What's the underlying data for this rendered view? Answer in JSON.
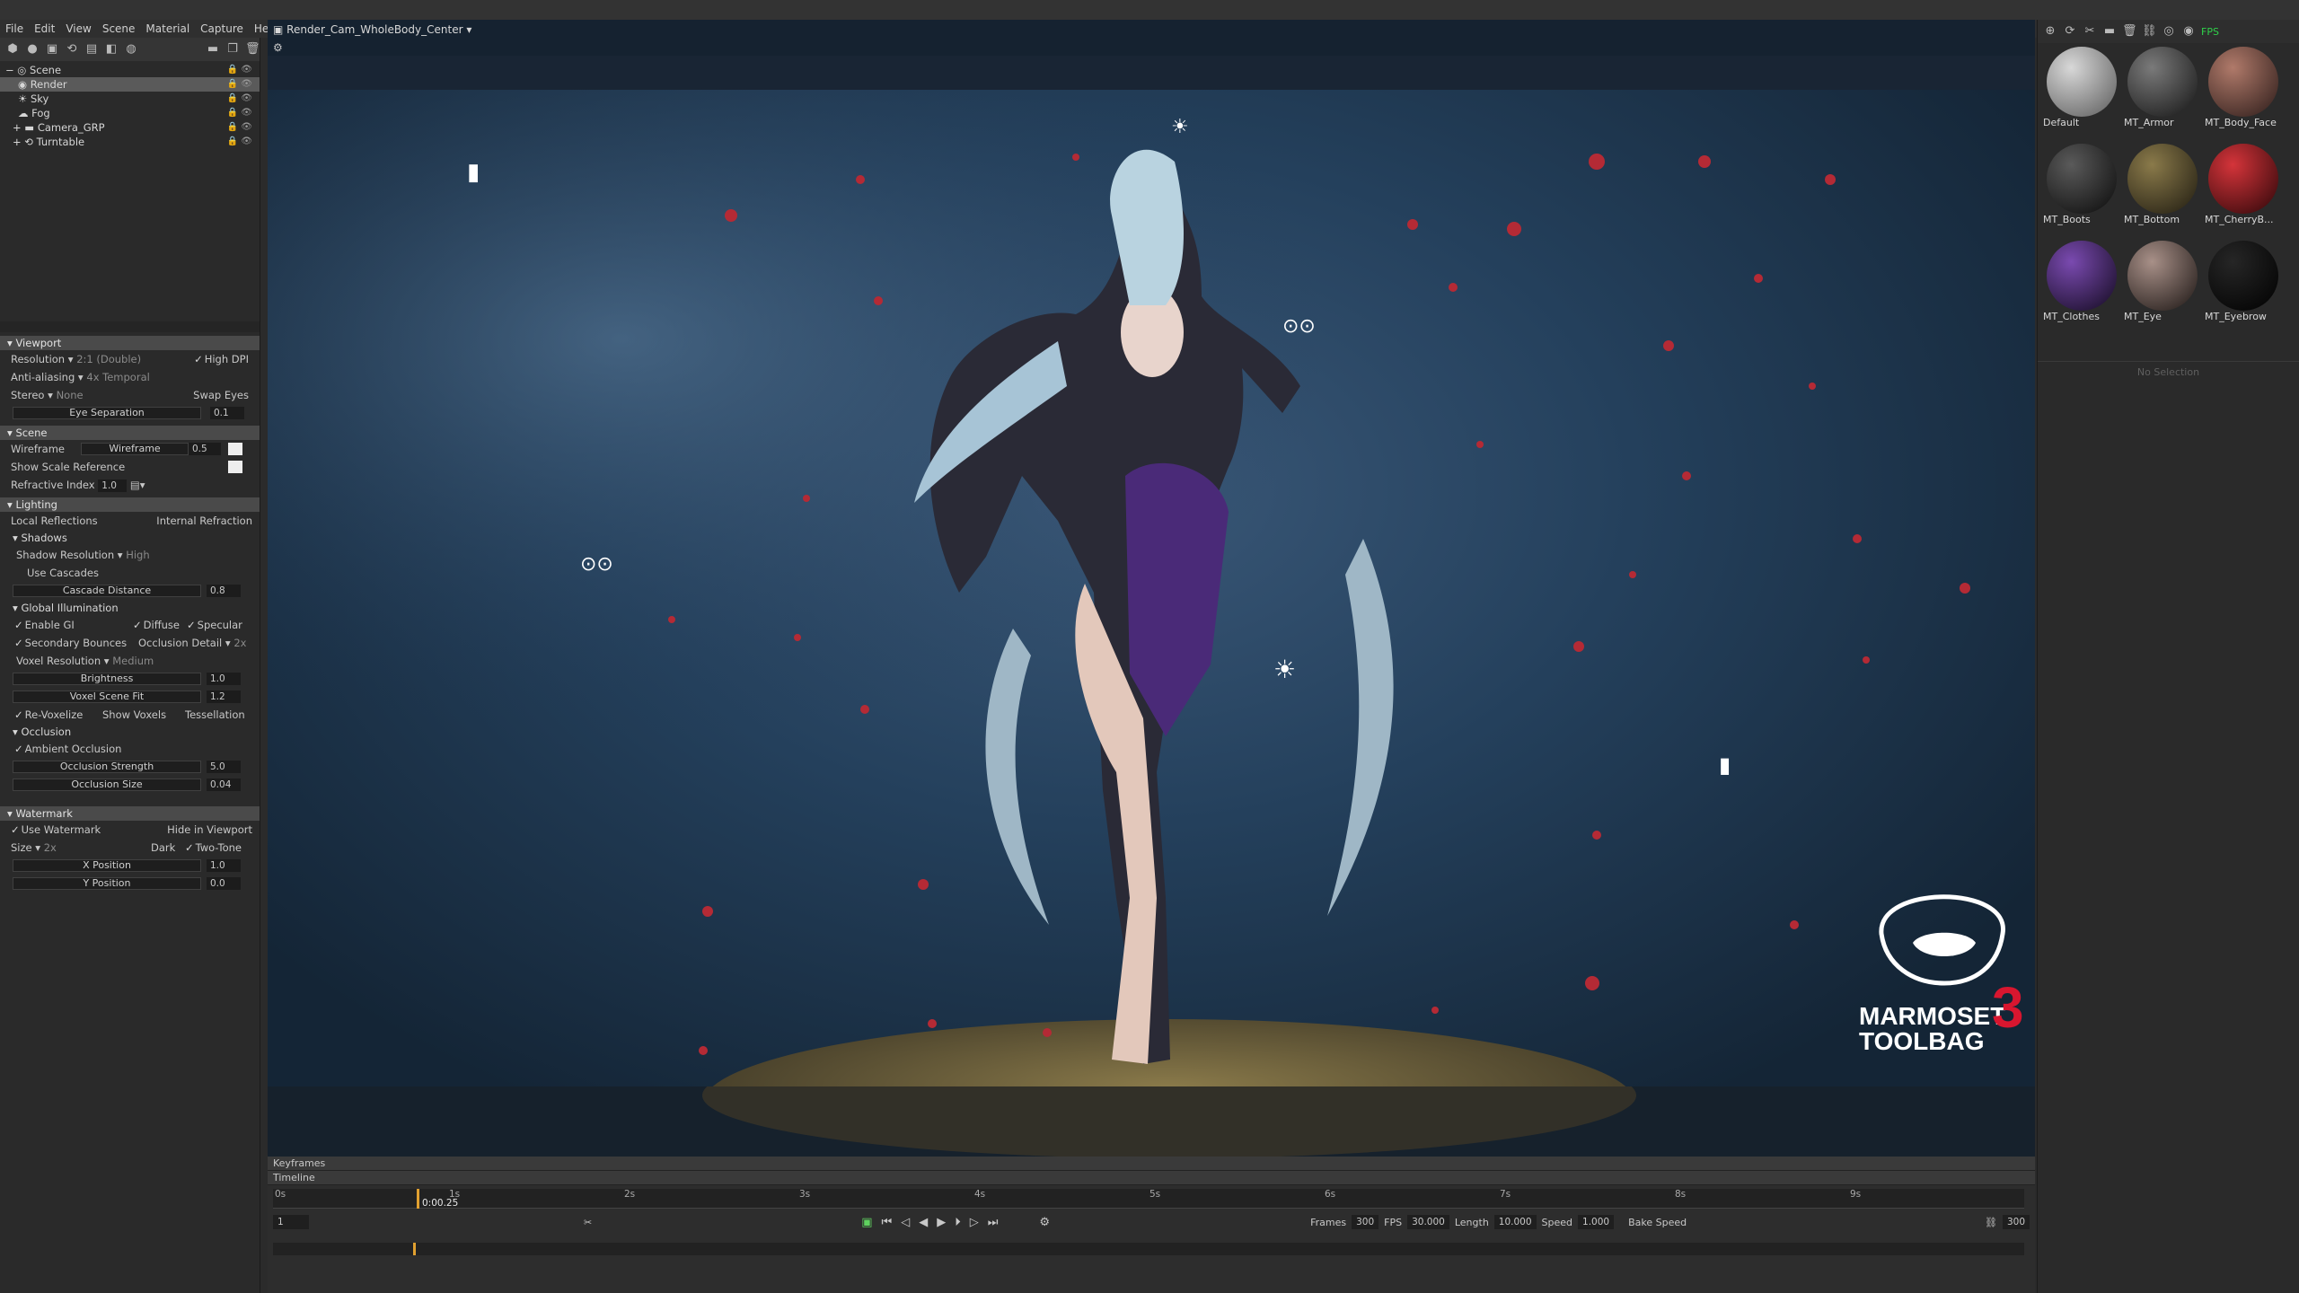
{
  "menu": [
    "File",
    "Edit",
    "View",
    "Scene",
    "Material",
    "Capture",
    "Help"
  ],
  "viewport_title": "Render_Cam_WholeBody_Center",
  "fps_label": "FPS",
  "scene_tree": [
    {
      "label": "Scene"
    },
    {
      "label": "Render"
    },
    {
      "label": "Sky"
    },
    {
      "label": "Fog"
    },
    {
      "label": "Camera_GRP"
    },
    {
      "label": "Turntable"
    }
  ],
  "viewport_section": {
    "title": "Viewport",
    "resolution_label": "Resolution",
    "resolution_value": "2:1 (Double)",
    "high_dpi": "High DPI",
    "aa_label": "Anti-aliasing",
    "aa_value": "4x Temporal",
    "stereo_label": "Stereo",
    "stereo_value": "None",
    "swap_eyes": "Swap Eyes",
    "eye_sep_label": "Eye Separation",
    "eye_sep_value": "0.1"
  },
  "scene_section": {
    "title": "Scene",
    "wireframe": "Wireframe",
    "wireframe_slider": "Wireframe",
    "wireframe_value": "0.5",
    "show_scale": "Show Scale Reference",
    "refractive_label": "Refractive Index",
    "refractive_value": "1.0"
  },
  "lighting_section": {
    "title": "Lighting",
    "local_reflections": "Local Reflections",
    "internal_refraction": "Internal Refraction",
    "shadows": "Shadows",
    "shadow_res_label": "Shadow Resolution",
    "shadow_res_value": "High",
    "use_cascades": "Use Cascades",
    "cascade_label": "Cascade Distance",
    "cascade_value": "0.8",
    "gi": "Global Illumination",
    "enable_gi": "Enable GI",
    "diffuse": "Diffuse",
    "specular": "Specular",
    "secondary": "Secondary Bounces",
    "occ_detail_label": "Occlusion Detail",
    "occ_detail_value": "2x",
    "voxel_res_label": "Voxel Resolution",
    "voxel_res_value": "Medium",
    "brightness_label": "Brightness",
    "brightness_value": "1.0",
    "voxel_fit_label": "Voxel Scene Fit",
    "voxel_fit_value": "1.2",
    "revoxelize": "Re-Voxelize",
    "show_voxels": "Show Voxels",
    "tessellation": "Tessellation",
    "occlusion": "Occlusion",
    "ambient_occ": "Ambient Occlusion",
    "occ_strength_label": "Occlusion Strength",
    "occ_strength_value": "5.0",
    "occ_size_label": "Occlusion Size",
    "occ_size_value": "0.04"
  },
  "watermark_section": {
    "title": "Watermark",
    "use_watermark": "Use Watermark",
    "hide_in_viewport": "Hide in Viewport",
    "size_label": "Size",
    "size_value": "2x",
    "dark": "Dark",
    "two_tone": "Two-Tone",
    "x_label": "X Position",
    "x_value": "1.0",
    "y_label": "Y Position",
    "y_value": "0.0"
  },
  "materials": [
    {
      "name": "Default",
      "color": "#9a9a9a"
    },
    {
      "name": "MT_Armor",
      "color": "#3a3a3a"
    },
    {
      "name": "MT_Body_Face",
      "color": "#6e5048"
    },
    {
      "name": "MT_Boots",
      "color": "#2c2c2c"
    },
    {
      "name": "MT_Bottom",
      "color": "#5a5030"
    },
    {
      "name": "MT_CherryB...",
      "color": "#8a1e1e"
    },
    {
      "name": "MT_Clothes",
      "color": "#3c2458"
    },
    {
      "name": "MT_Eye",
      "color": "#6a5a55"
    },
    {
      "name": "MT_Eyebrow",
      "color": "#0c0c0c"
    }
  ],
  "no_selection": "No Selection",
  "timeline": {
    "keyframes_label": "Keyframes",
    "timeline_label": "Timeline",
    "ticks": [
      "0s",
      "1s",
      "2s",
      "3s",
      "4s",
      "5s",
      "6s",
      "7s",
      "8s",
      "9s"
    ],
    "current_time": "0:00.25",
    "frame_field": "1",
    "frames_label": "Frames",
    "frames_value": "300",
    "fps_label": "FPS",
    "fps_value": "30.000",
    "length_label": "Length",
    "length_value": "10.000",
    "speed_label": "Speed",
    "speed_value": "1.000",
    "bake_speed": "Bake Speed",
    "end_frame": "300"
  },
  "logo": {
    "line1": "MARMOSET",
    "line2": "TOOLBAG",
    "number": "3"
  }
}
